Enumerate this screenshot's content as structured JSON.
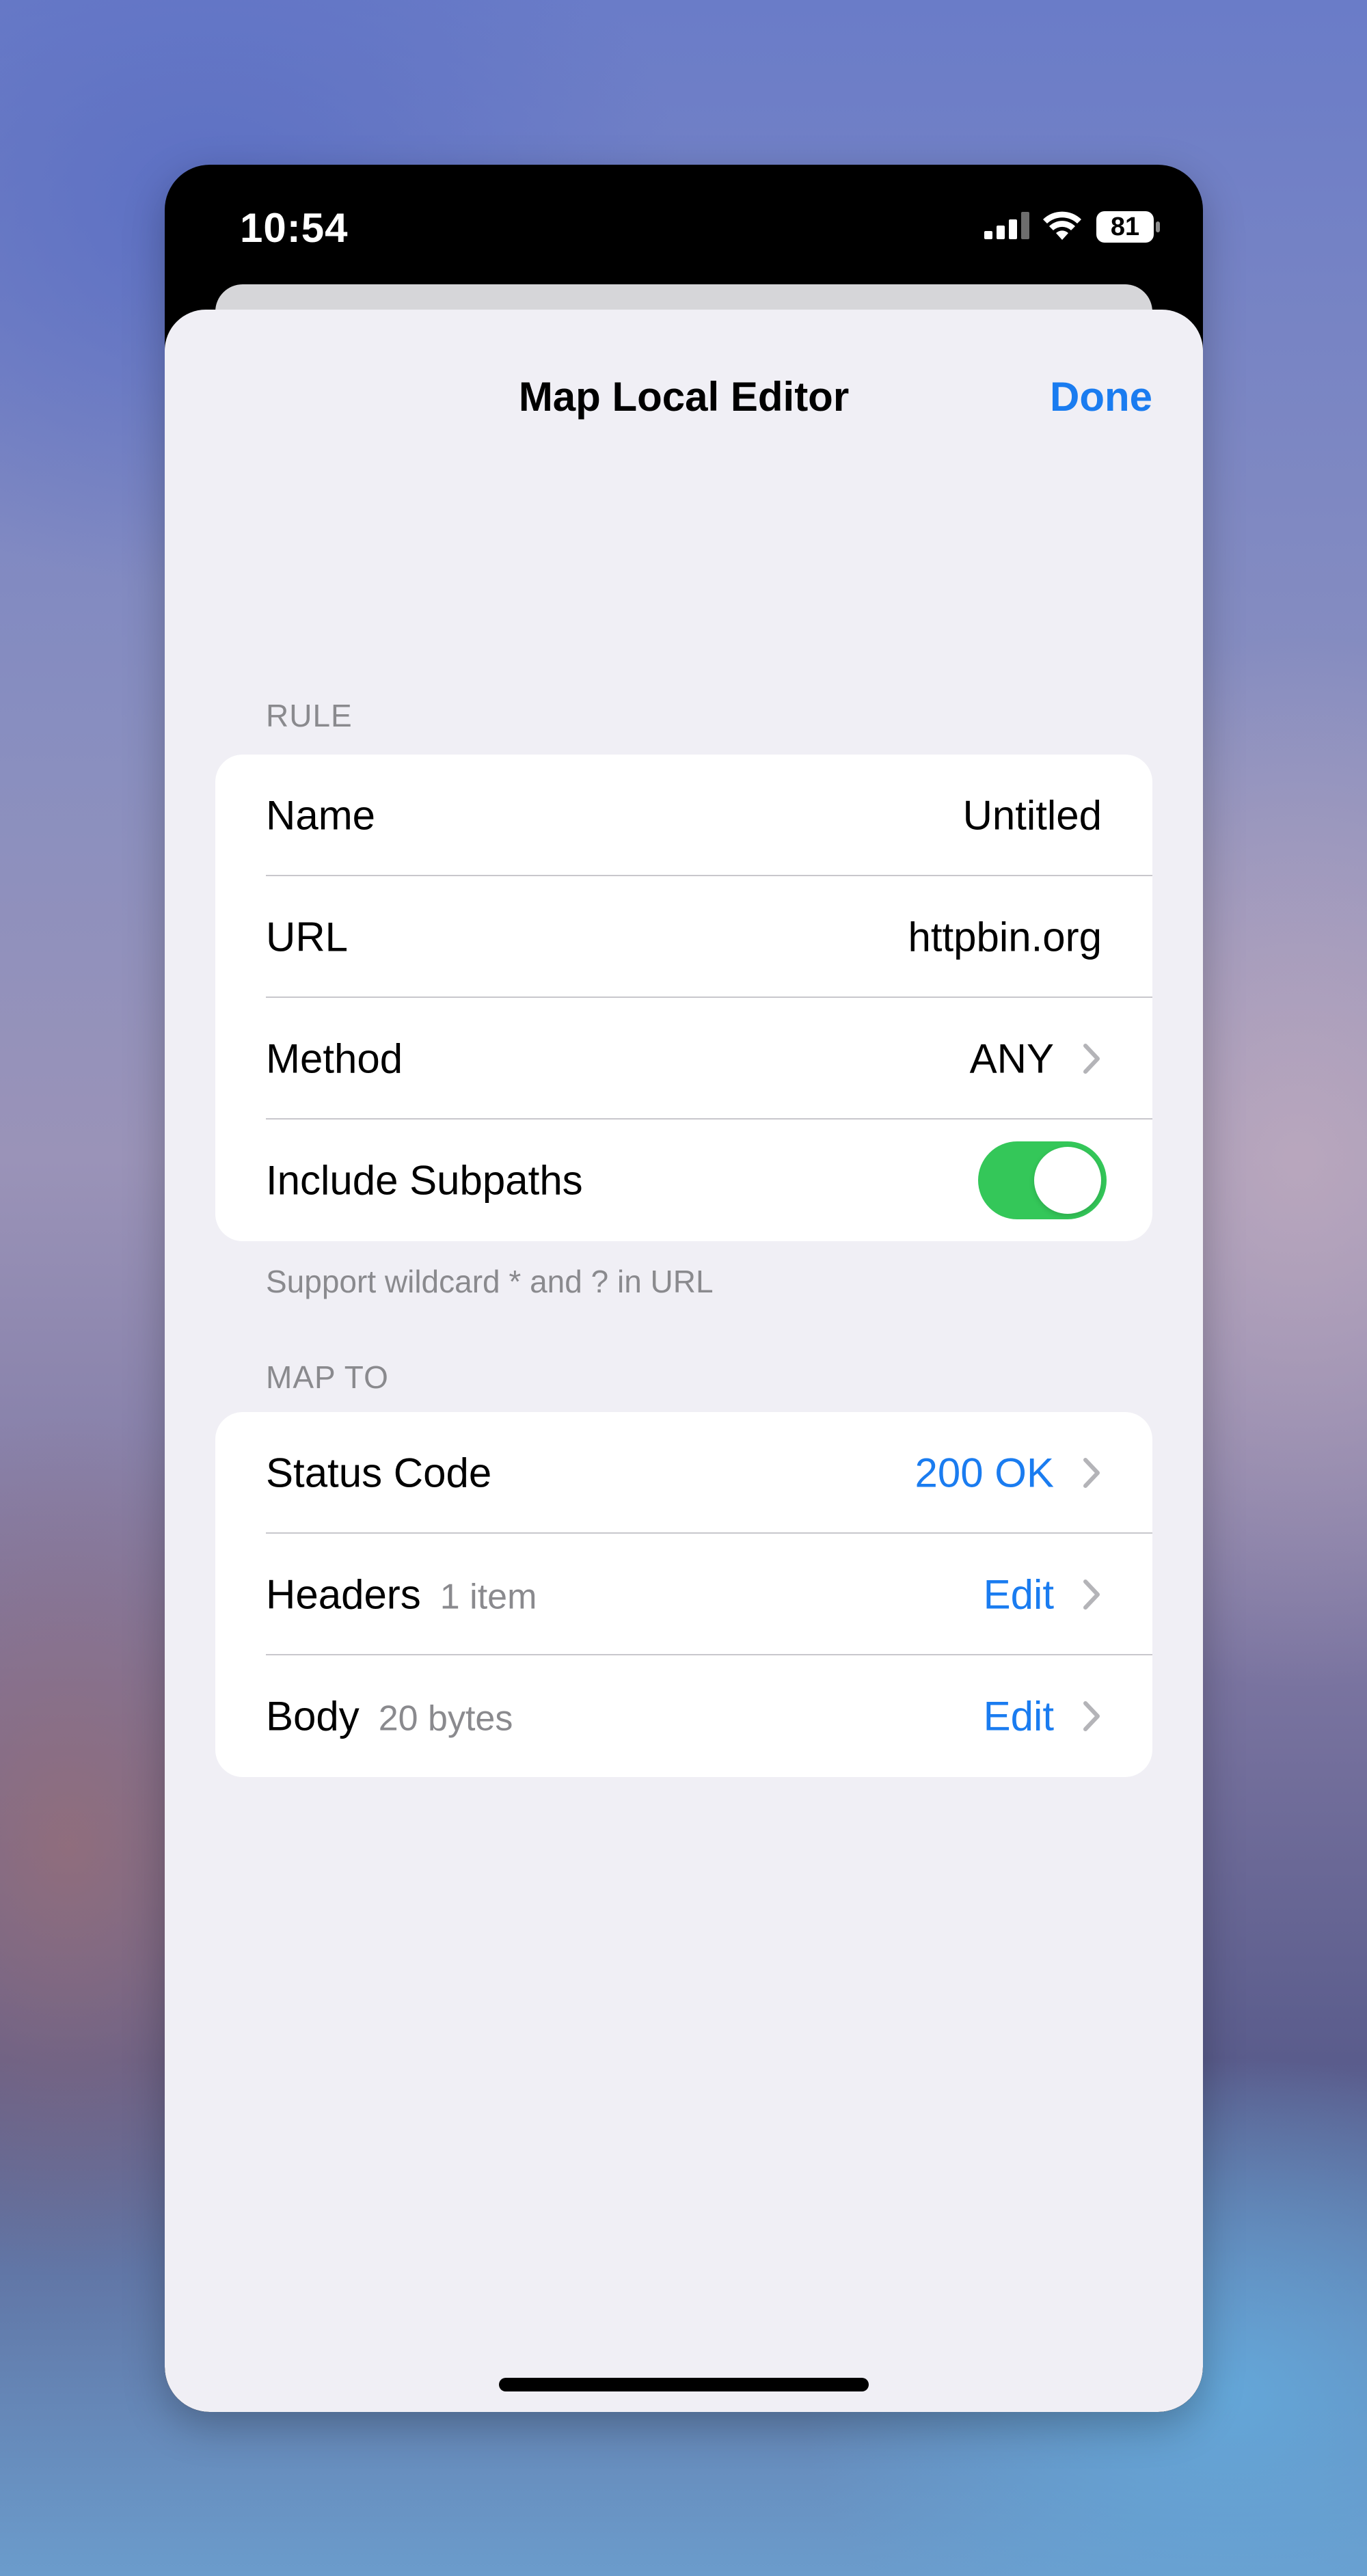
{
  "status_bar": {
    "time": "10:54",
    "battery": "81",
    "icons": [
      "cellular-signal-icon",
      "wifi-icon",
      "battery-icon"
    ]
  },
  "nav": {
    "title": "Map Local Editor",
    "done_label": "Done"
  },
  "rule_section": {
    "header": "RULE",
    "name_label": "Name",
    "name_value": "Untitled",
    "url_label": "URL",
    "url_value": "httpbin.org",
    "method_label": "Method",
    "method_value": "ANY",
    "subpaths_label": "Include Subpaths",
    "subpaths_enabled": true,
    "footer": "Support wildcard * and ? in URL"
  },
  "map_to_section": {
    "header": "MAP TO",
    "status_label": "Status Code",
    "status_value": "200 OK",
    "headers_label": "Headers",
    "headers_count": "1 item",
    "headers_action": "Edit",
    "body_label": "Body",
    "body_size": "20 bytes",
    "body_action": "Edit"
  },
  "colors": {
    "accent": "#1a7cf0",
    "toggle_on": "#34c759",
    "secondary_text": "#8a8a8e",
    "grouped_background": "#f0eff5"
  }
}
